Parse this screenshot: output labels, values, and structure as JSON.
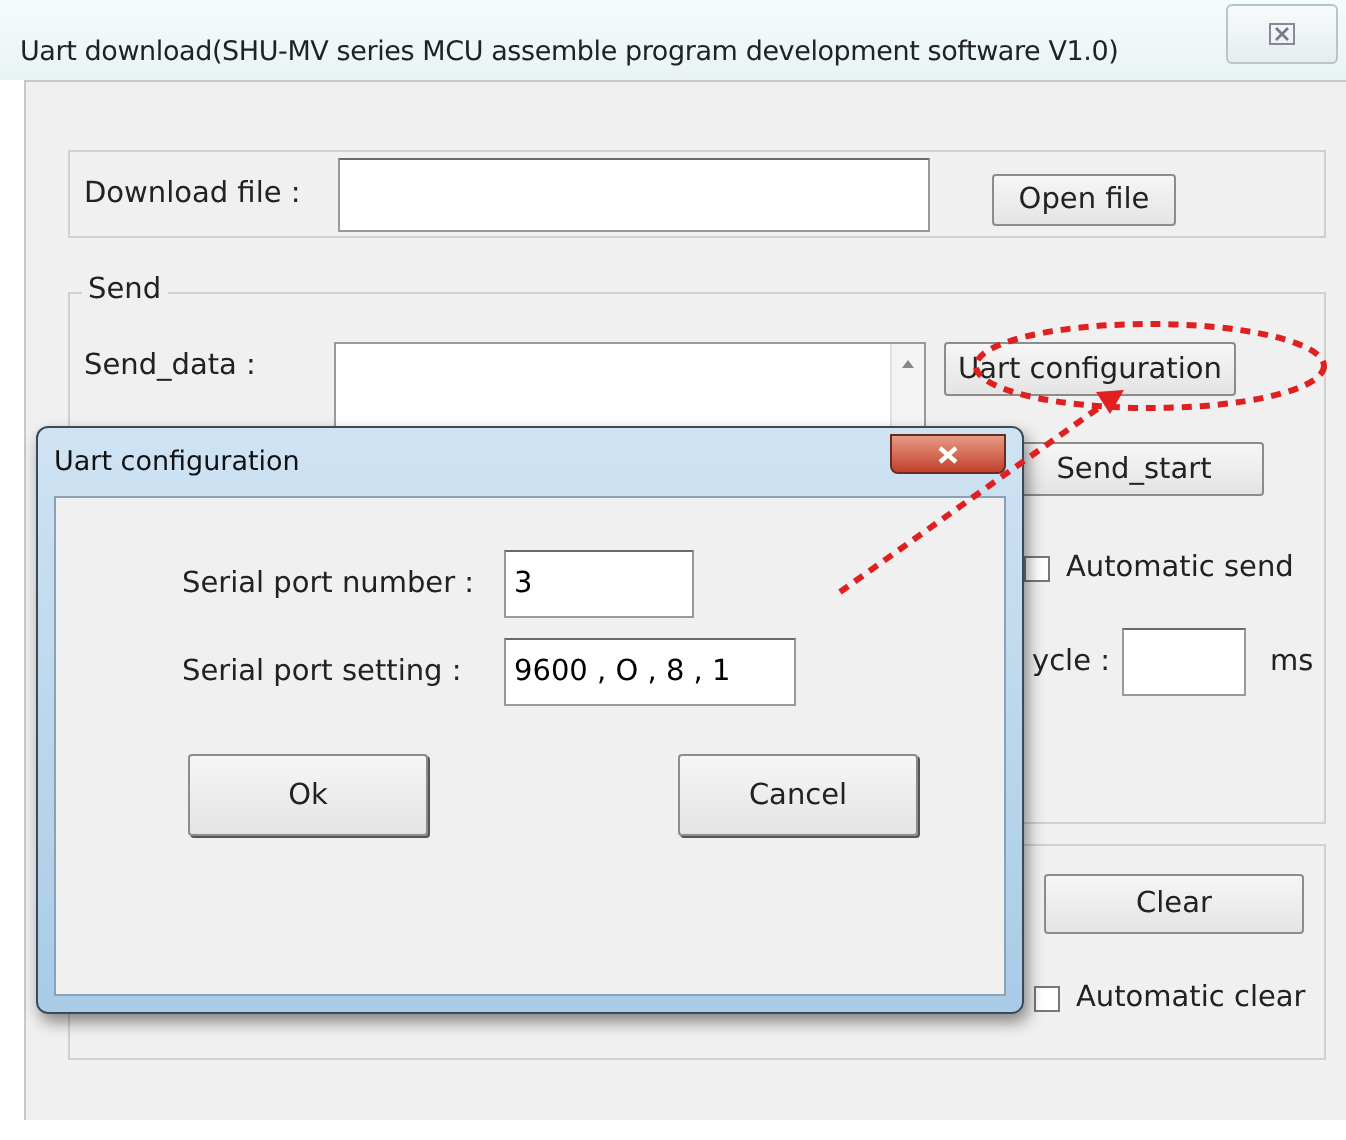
{
  "window": {
    "title": "Uart download(SHU-MV series MCU assemble program development software V1.0)"
  },
  "download": {
    "label": "Download file :",
    "button": "Open file"
  },
  "send": {
    "legend": "Send",
    "data_label": "Send_data :",
    "config_button": "Uart configuration",
    "start_button": "Send_start",
    "auto_send": {
      "label": "Automatic send",
      "checked": false
    },
    "cycle_label": "ycle :",
    "cycle_unit": "ms"
  },
  "receive": {
    "clear_button": "Clear",
    "auto_clear": {
      "label": "Automatic clear",
      "checked": false
    }
  },
  "dialog": {
    "title": "Uart configuration",
    "fields": [
      {
        "label": "Serial port number :",
        "value": "3"
      },
      {
        "label": "Serial port setting :",
        "value": "9600 , O , 8 , 1"
      }
    ],
    "buttons": [
      "Ok",
      "Cancel"
    ]
  }
}
